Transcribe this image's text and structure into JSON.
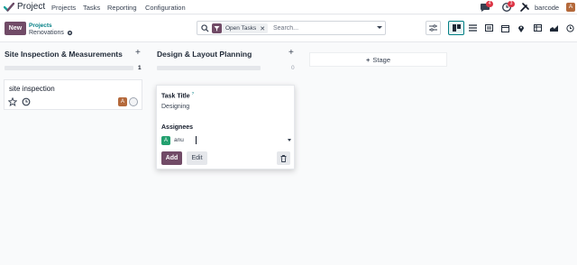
{
  "app": {
    "name": "Project"
  },
  "menu": [
    "Projects",
    "Tasks",
    "Reporting",
    "Configuration"
  ],
  "systray": {
    "messages_count": "4",
    "activities_count": "3",
    "company": "barcode",
    "user_initial": "A"
  },
  "control": {
    "new_label": "New",
    "breadcrumb_parent": "Projects",
    "breadcrumb_current": "Renovations",
    "search": {
      "facet": "Open Tasks",
      "placeholder": "Search..."
    }
  },
  "columns": [
    {
      "title": "Site Inspection & Measurements",
      "count": "1"
    },
    {
      "title": "Design & Layout Planning",
      "count": "0"
    }
  ],
  "card": {
    "title": "site inspection",
    "avatar_initial": "A"
  },
  "quick_create": {
    "task_title_label": "Task Title",
    "task_title_marker": "?",
    "task_title_value": "Designing",
    "assignees_label": "Assignees",
    "assignee_initial": "A",
    "assignee_name": "anu",
    "add_label": "Add",
    "edit_label": "Edit"
  },
  "add_stage_label": "Stage",
  "colors": {
    "primary": "#714b67",
    "accent": "#017e84",
    "badge": "#dc3545"
  }
}
